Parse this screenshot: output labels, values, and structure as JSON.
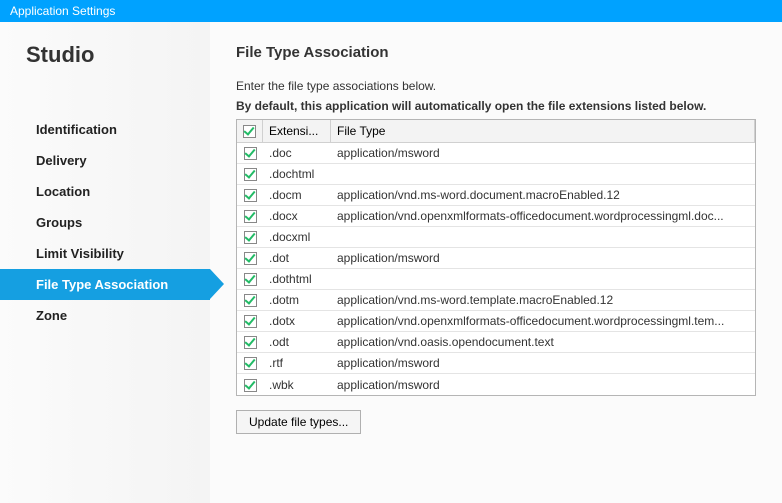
{
  "titlebar": "Application Settings",
  "sidebar": {
    "title": "Studio",
    "items": [
      {
        "label": "Identification"
      },
      {
        "label": "Delivery"
      },
      {
        "label": "Location"
      },
      {
        "label": "Groups"
      },
      {
        "label": "Limit Visibility"
      },
      {
        "label": "File Type Association"
      },
      {
        "label": "Zone"
      }
    ],
    "active": 5
  },
  "main": {
    "title": "File Type Association",
    "intro1": "Enter the file type associations below.",
    "intro2": "By default, this application will automatically open the file extensions listed below.",
    "columns": {
      "check": "",
      "extension": "Extensi...",
      "filetype": "File Type"
    },
    "rows": [
      {
        "checked": true,
        "ext": ".doc",
        "ft": "application/msword"
      },
      {
        "checked": true,
        "ext": ".dochtml",
        "ft": ""
      },
      {
        "checked": true,
        "ext": ".docm",
        "ft": "application/vnd.ms-word.document.macroEnabled.12"
      },
      {
        "checked": true,
        "ext": ".docx",
        "ft": "application/vnd.openxmlformats-officedocument.wordprocessingml.doc..."
      },
      {
        "checked": true,
        "ext": ".docxml",
        "ft": ""
      },
      {
        "checked": true,
        "ext": ".dot",
        "ft": "application/msword"
      },
      {
        "checked": true,
        "ext": ".dothtml",
        "ft": ""
      },
      {
        "checked": true,
        "ext": ".dotm",
        "ft": "application/vnd.ms-word.template.macroEnabled.12"
      },
      {
        "checked": true,
        "ext": ".dotx",
        "ft": "application/vnd.openxmlformats-officedocument.wordprocessingml.tem..."
      },
      {
        "checked": true,
        "ext": ".odt",
        "ft": "application/vnd.oasis.opendocument.text"
      },
      {
        "checked": true,
        "ext": ".rtf",
        "ft": "application/msword"
      },
      {
        "checked": true,
        "ext": ".wbk",
        "ft": "application/msword"
      }
    ],
    "update_btn": "Update file types..."
  }
}
